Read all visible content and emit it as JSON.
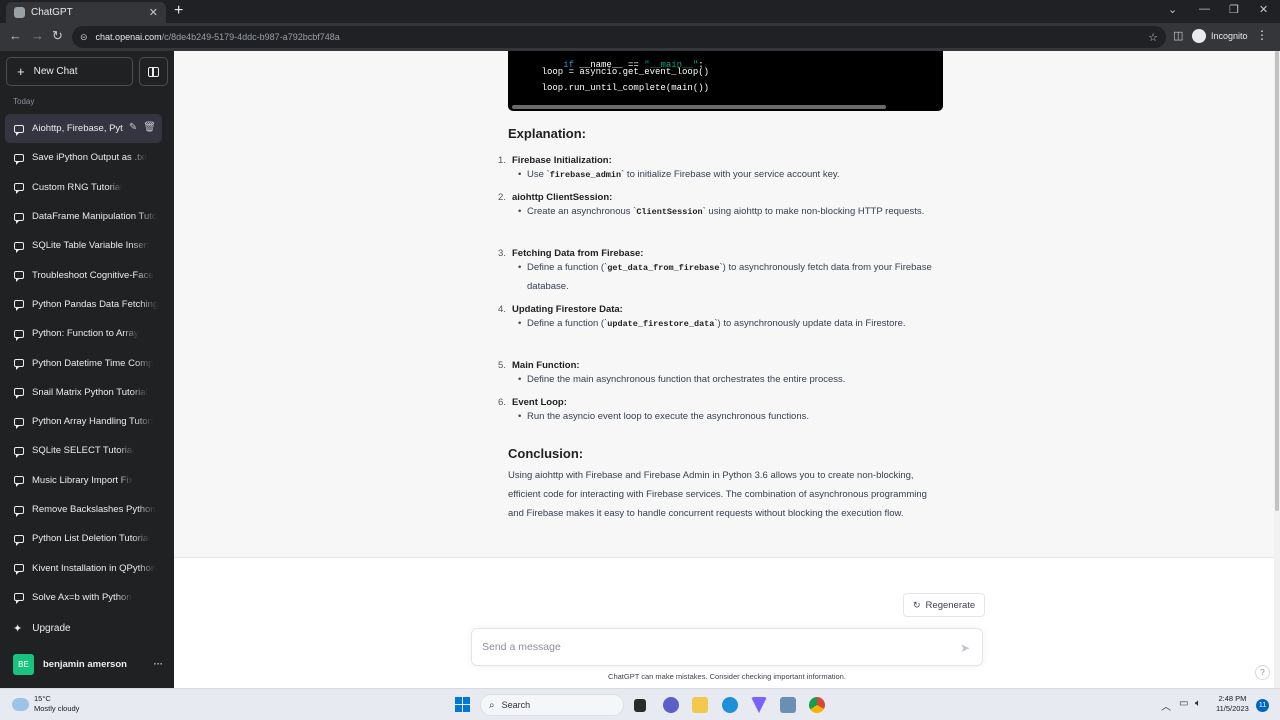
{
  "browser": {
    "tab_title": "ChatGPT",
    "tab_close": "✕",
    "new_tab": "+",
    "url_host": "chat.openai.com",
    "url_path": "/c/8de4b249-5179-4ddc-b987-a792bcbf748a",
    "profile_label": "Incognito"
  },
  "sidebar": {
    "new_chat_label": "New Chat",
    "section_label": "Today",
    "items": [
      {
        "label": "Aiohttp, Firebase, Pyt"
      },
      {
        "label": "Save iPython Output as .txt"
      },
      {
        "label": "Custom RNG Tutorial"
      },
      {
        "label": "DataFrame Manipulation Tuto"
      },
      {
        "label": "SQLite Table Variable Insert"
      },
      {
        "label": "Troubleshoot Cognitive-Face"
      },
      {
        "label": "Python Pandas Data Fetching"
      },
      {
        "label": "Python: Function to Array"
      },
      {
        "label": "Python Datetime Time Comp"
      },
      {
        "label": "Snail Matrix Python Tutorial"
      },
      {
        "label": "Python Array Handling Tutori"
      },
      {
        "label": "SQLite SELECT Tutorial"
      },
      {
        "label": "Music Library Import Fix"
      },
      {
        "label": "Remove Backslashes Python"
      },
      {
        "label": "Python List Deletion Tutorial"
      },
      {
        "label": "Kivent Installation in QPython"
      },
      {
        "label": "Solve Ax=b with Python"
      }
    ],
    "upgrade_label": "Upgrade",
    "user_initials": "BE",
    "user_name": "benjamin amerson",
    "user_more": "···"
  },
  "code": {
    "line1_kw": "if",
    "line1_a": " __name__ == ",
    "line1_str": "\"__main__\"",
    "line1_b": ":",
    "line2": "    loop = asyncio.get_event_loop()",
    "line3": "    loop.run_until_complete(main())"
  },
  "answer": {
    "explanation_title": "Explanation:",
    "steps": [
      {
        "num": "1.",
        "title": "Firebase Initialization:",
        "pre": "Use `",
        "code": "firebase_admin",
        "post": "` to initialize Firebase with your service account key."
      },
      {
        "num": "2.",
        "title": "aiohttp ClientSession:",
        "pre": "Create an asynchronous `",
        "code": "ClientSession",
        "post": "` using aiohttp to make non-blocking HTTP requests."
      },
      {
        "num": "3.",
        "title": "Fetching Data from Firebase:",
        "pre": "Define a function (`",
        "code": "get_data_from_firebase",
        "post": "`) to asynchronously fetch data from your Firebase database."
      },
      {
        "num": "4.",
        "title": "Updating Firestore Data:",
        "pre": "Define a function (`",
        "code": "update_firestore_data",
        "post": "`) to asynchronously update data in Firestore."
      },
      {
        "num": "5.",
        "title": "Main Function:",
        "text": "Define the main asynchronous function that orchestrates the entire process."
      },
      {
        "num": "6.",
        "title": "Event Loop:",
        "text": "Run the asyncio event loop to execute the asynchronous functions."
      }
    ],
    "conclusion_title": "Conclusion:",
    "conclusion_text": "Using aiohttp with Firebase and Firebase Admin in Python 3.6 allows you to create non-blocking, efficient code for interacting with Firebase services. The combination of asynchronous programming and Firebase makes it easy to handle concurrent requests without blocking the execution flow."
  },
  "composer": {
    "regenerate_label": "Regenerate",
    "placeholder": "Send a message",
    "disclaimer": "ChatGPT can make mistakes. Consider checking important information.",
    "help": "?"
  },
  "taskbar": {
    "temp": "15°C",
    "weather": "Mostly cloudy",
    "search_label": "Search",
    "time": "2:48 PM",
    "date": "11/5/2023",
    "notifications": "11"
  },
  "colors": {
    "sidebar_bg": "#202123",
    "accent_green": "#19c37d",
    "answer_bg": "#f7f7f8"
  }
}
